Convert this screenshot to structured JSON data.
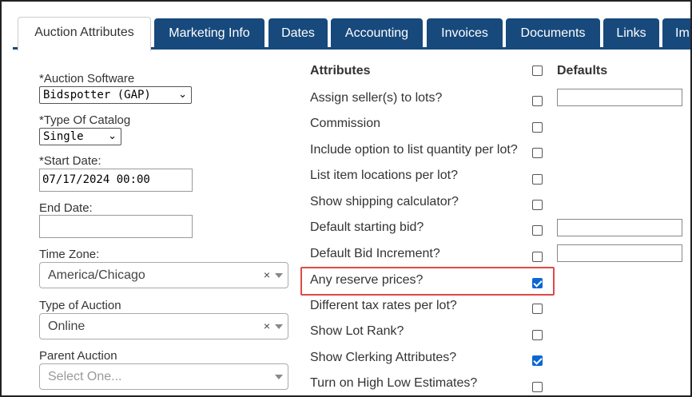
{
  "tabs": [
    {
      "label": "Auction Attributes",
      "active": true
    },
    {
      "label": "Marketing Info"
    },
    {
      "label": "Dates"
    },
    {
      "label": "Accounting"
    },
    {
      "label": "Invoices"
    },
    {
      "label": "Documents"
    },
    {
      "label": "Links"
    },
    {
      "label": "Im"
    }
  ],
  "form": {
    "auction_software": {
      "label": "*Auction Software",
      "value": "Bidspotter (GAP)"
    },
    "catalog_type": {
      "label": "*Type Of Catalog",
      "value": "Single"
    },
    "start_date": {
      "label": "*Start Date:",
      "value": "07/17/2024 00:00"
    },
    "end_date": {
      "label": "End Date:",
      "value": ""
    },
    "time_zone": {
      "label": "Time Zone:",
      "value": "America/Chicago"
    },
    "auction_type": {
      "label": "Type of Auction",
      "value": "Online"
    },
    "parent_auction": {
      "label": "Parent Auction",
      "placeholder": "Select One..."
    },
    "clear_symbol": "×"
  },
  "attributes": {
    "header": "Attributes",
    "defaults_header": "Defaults",
    "items": [
      {
        "label": "Assign seller(s) to lots?",
        "checked": false,
        "has_default": true
      },
      {
        "label": "Commission",
        "checked": false
      },
      {
        "label": "Include option to list quantity per lot?",
        "checked": false
      },
      {
        "label": "List item locations per lot?",
        "checked": false
      },
      {
        "label": "Show shipping calculator?",
        "checked": false
      },
      {
        "label": "Default starting bid?",
        "checked": false,
        "has_default": true
      },
      {
        "label": "Default Bid Increment?",
        "checked": false,
        "has_default": true
      },
      {
        "label": "Any reserve prices?",
        "checked": true
      },
      {
        "label": "Different tax rates per lot?",
        "checked": false
      },
      {
        "label": "Show Lot Rank?",
        "checked": false
      },
      {
        "label": "Show Clerking Attributes?",
        "checked": true
      },
      {
        "label": "Turn on High Low Estimates?",
        "checked": false
      }
    ]
  },
  "colors": {
    "tab_bg": "#17497c",
    "checkbox_checked": "#0b67d1",
    "highlight": "#e04848"
  }
}
